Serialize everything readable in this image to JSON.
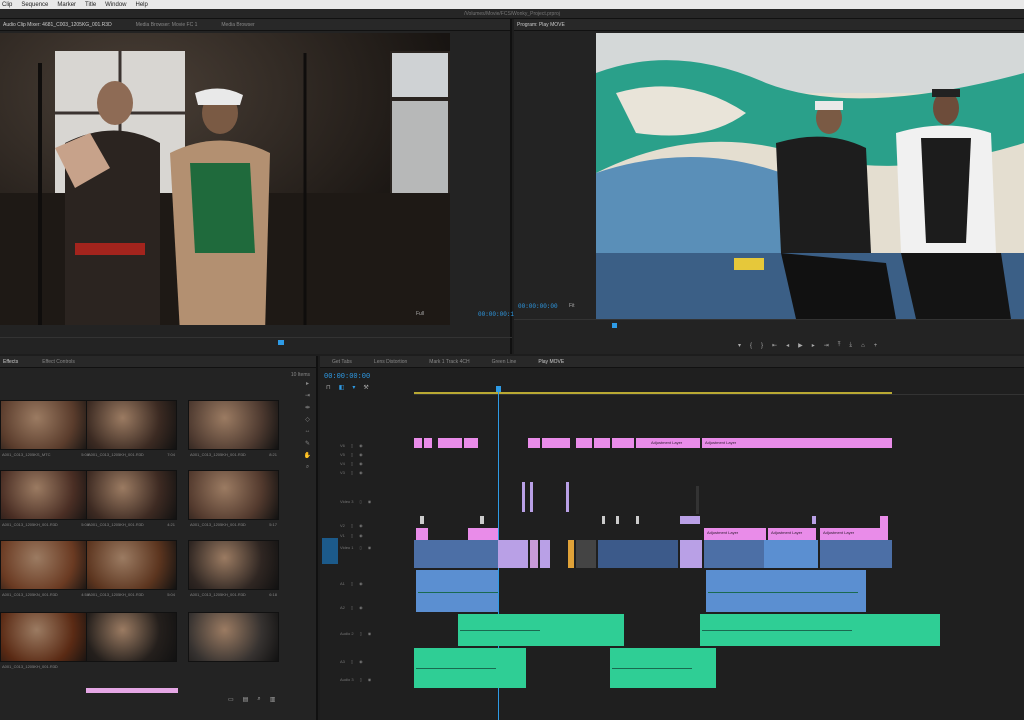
{
  "menubar": {
    "items": [
      "Clip",
      "Sequence",
      "Marker",
      "Title",
      "Window",
      "Help"
    ]
  },
  "titlebar": {
    "text": "/Volumes/Movie/FCS/Wonky_Project.prproj"
  },
  "source": {
    "tabs": [
      "Audio Clip Mixer: 4681_C003_1205KG_001.R3D",
      "Media Browser: Movie FC 1",
      "Media Browser"
    ],
    "fit": "Full",
    "timecode": "00:00:00:11"
  },
  "program": {
    "tab": "Program: Play MOVE",
    "timecode": "00:00:00:00",
    "fit": "Fit"
  },
  "project": {
    "tabs": [
      "Effects",
      "Effect Controls"
    ],
    "count": "10 Items",
    "items": [
      {
        "name": "A001_C013_1205KS_MTC",
        "dur": "5:08"
      },
      {
        "name": "A001_C013_1205KH_001.R3D",
        "dur": "7:04"
      },
      {
        "name": "A001_C013_1205KH_001.R3D",
        "dur": "8:21"
      },
      {
        "name": "A001_C013_1205KH_001.R3D",
        "dur": "5:08"
      },
      {
        "name": "A001_C013_1205KH_001.R3D",
        "dur": "4:21"
      },
      {
        "name": "A001_C013_1205KH_001.R3D",
        "dur": "5:17"
      },
      {
        "name": "A001_C013_1205KN_001.R3D",
        "dur": "4:58"
      },
      {
        "name": "A001_C013_1205KH_001.R3D",
        "dur": "5:04"
      },
      {
        "name": "A001_C013_1205KH_001.R3D",
        "dur": "6:18"
      },
      {
        "name": "A001_C013_1205KH_001.R3D",
        "dur": ""
      },
      {
        "name": "",
        "dur": ""
      },
      {
        "name": "",
        "dur": ""
      }
    ]
  },
  "timeline": {
    "tabs": [
      "Get Tabs",
      "Lens Distortion",
      "Mark 1 Track 4CH",
      "Green Line",
      "Play MOVE"
    ],
    "timecode": "00:00:00:00",
    "tracks": [
      "V6",
      "V5",
      "V4",
      "V3",
      "Video 3",
      "V2",
      "V1",
      "Video 1",
      "A1",
      "A2",
      "Audio 2",
      "A3",
      "Audio 3"
    ],
    "clips": {
      "adj1": "Adjustment Layer",
      "adj2": "Adjustment Layer",
      "adj3": "Adjustment Layer",
      "adj4": "Adjustment Layer",
      "adj5": "Adjustment Layer"
    }
  },
  "colors": {
    "accent": "#2e9be6",
    "adjustment": "#e98ce9",
    "audio": "#2fce95",
    "video": "#5b8fd1"
  }
}
